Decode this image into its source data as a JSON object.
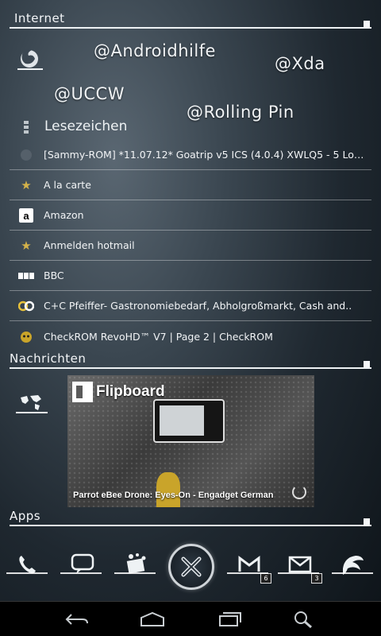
{
  "sections": {
    "internet": "Internet",
    "nachrichten": "Nachrichten",
    "apps": "Apps"
  },
  "tags": [
    "@Androidhilfe",
    "@Xda",
    "@UCCW",
    "@Rolling Pin"
  ],
  "bookmarks_title": "Lesezeichen",
  "bookmarks": [
    {
      "icon": "android-icon",
      "label": "[Sammy-ROM] *11.07.12* Goatrip v5 ICS (4.0.4) XWLQ5 - 5 Lock.."
    },
    {
      "icon": "star-icon",
      "label": "A la carte"
    },
    {
      "icon": "amazon-icon",
      "label": "Amazon"
    },
    {
      "icon": "star-icon",
      "label": "Anmelden hotmail"
    },
    {
      "icon": "bbc-icon",
      "label": "BBC"
    },
    {
      "icon": "cc-icon",
      "label": "C+C Pfeiffer- Gastronomiebedarf, Abholgroßmarkt, Cash and.."
    },
    {
      "icon": "checkrom-icon",
      "label": "CheckROM RevoHD™ V7 | Page 2 | CheckROM"
    }
  ],
  "news": {
    "app_name": "Flipboard",
    "headline": "Parrot eBee Drone: Eyes-On - Engadget German"
  },
  "dock": {
    "gmail_badge": "6",
    "mail_badge": "3"
  },
  "colors": {
    "accent_line": "#eef2f4",
    "star": "#d4b24a"
  }
}
